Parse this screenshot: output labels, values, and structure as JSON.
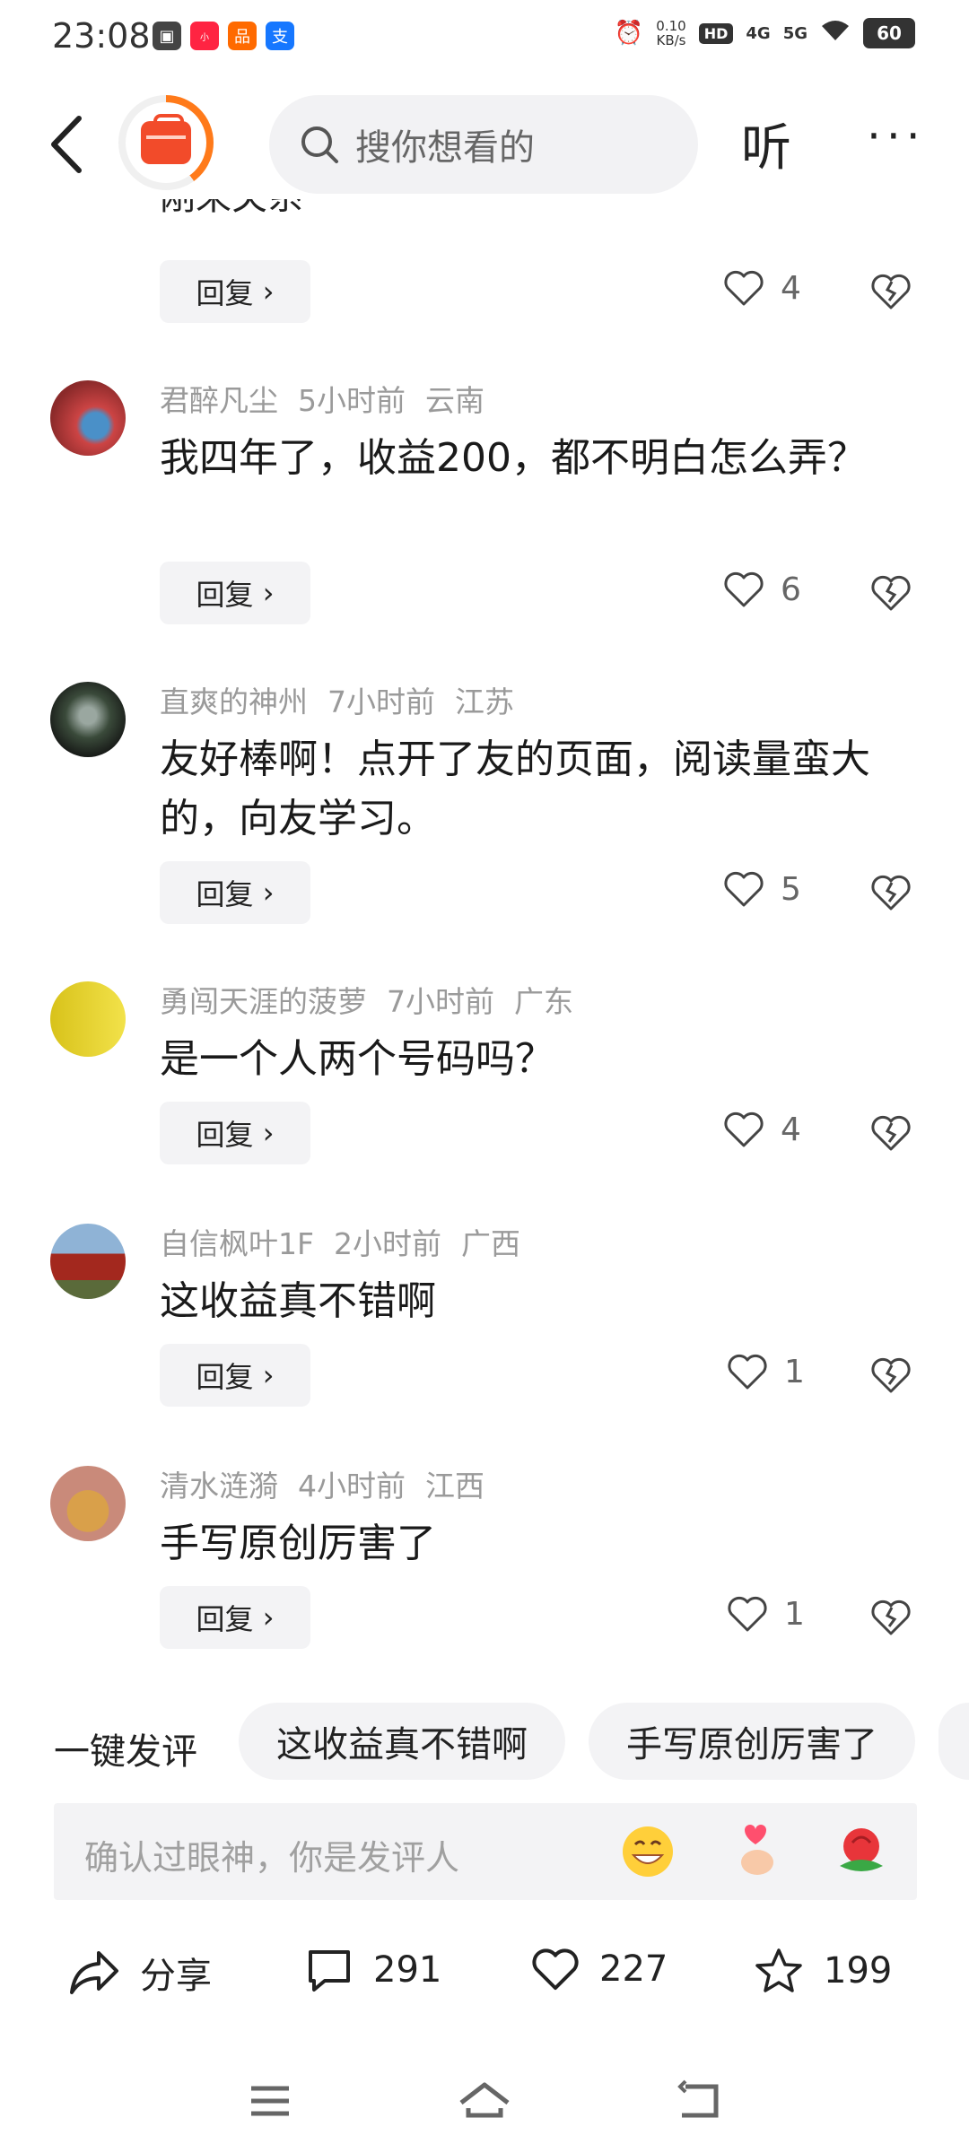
{
  "status_bar": {
    "time": "23:08",
    "net_speed": "0.10",
    "net_unit": "KB/s",
    "hd_label": "HD",
    "sig1": "4G",
    "sig2": "5G",
    "battery": "60"
  },
  "header": {
    "search_placeholder": "搜你想看的",
    "listen_label": "听",
    "more_label": "···"
  },
  "partial_comment": {
    "text": "刚来关系",
    "reply_label": "回复",
    "likes": "4"
  },
  "comments": [
    {
      "user": "君醉凡尘",
      "time": "5小时前",
      "location": "云南",
      "text": "我四年了，收益200，都不明白怎么弄？",
      "reply_label": "回复",
      "likes": "6"
    },
    {
      "user": "直爽的神州",
      "time": "7小时前",
      "location": "江苏",
      "text": "友好棒啊！点开了友的页面，阅读量蛮大的，向友学习。",
      "reply_label": "回复",
      "likes": "5"
    },
    {
      "user": "勇闯天涯的菠萝",
      "time": "7小时前",
      "location": "广东",
      "text": "是一个人两个号码吗？",
      "reply_label": "回复",
      "likes": "4"
    },
    {
      "user": "自信枫叶1F",
      "time": "2小时前",
      "location": "广西",
      "text": "这收益真不错啊",
      "reply_label": "回复",
      "likes": "1"
    },
    {
      "user": "清水涟漪",
      "time": "4小时前",
      "location": "江西",
      "text": "手写原创厉害了",
      "reply_label": "回复",
      "likes": "1"
    }
  ],
  "quick_comment": {
    "label": "一键发评",
    "chips": [
      "这收益真不错啊",
      "手写原创厉害了"
    ]
  },
  "input": {
    "placeholder": "确认过眼神，你是发评人"
  },
  "actions": {
    "share_label": "分享",
    "comments_count": "291",
    "likes_count": "227",
    "favorites_count": "199"
  },
  "colors": {
    "accent": "#f24b2a",
    "chip_bg": "#f3f3f5",
    "meta_text": "#9a9a9a"
  }
}
